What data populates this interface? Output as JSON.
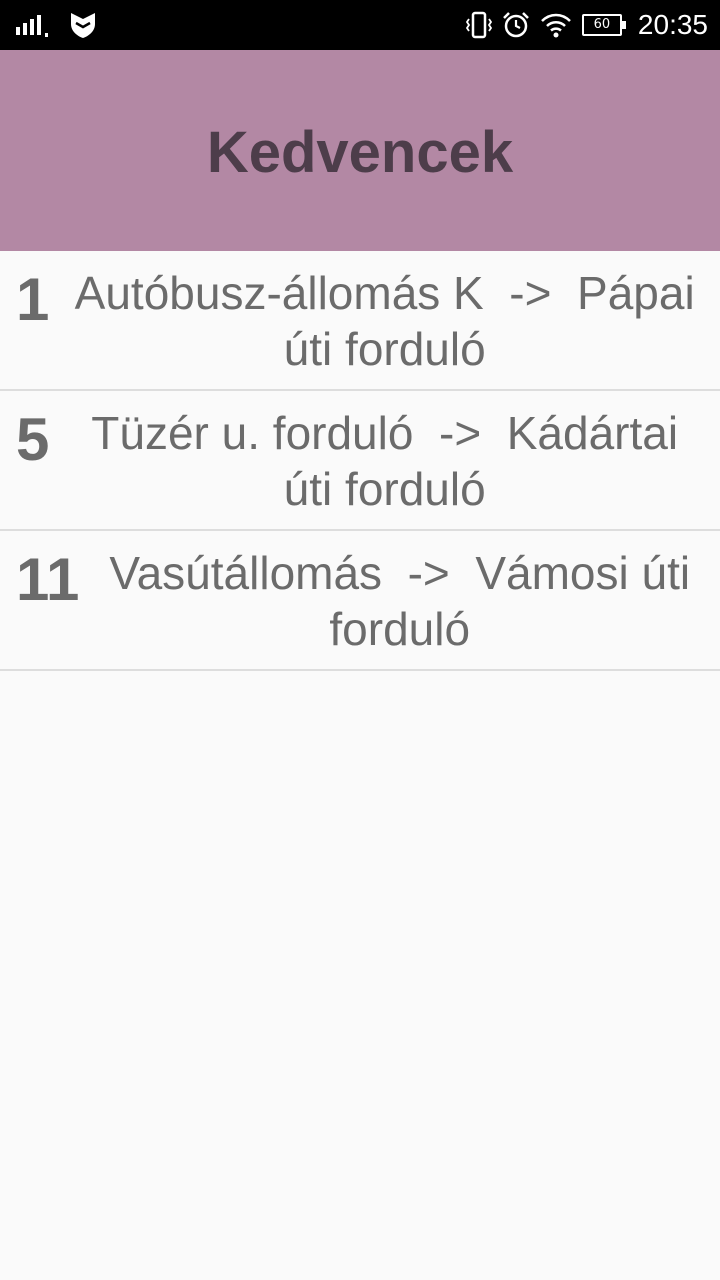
{
  "status_bar": {
    "time": "20:35",
    "battery_level": "60",
    "icons": [
      "signal-icon",
      "shield-icon",
      "vibrate-icon",
      "alarm-icon",
      "wifi-icon",
      "battery-icon"
    ]
  },
  "header": {
    "title": "Kedvencek",
    "background_color": "#b388a4"
  },
  "favorites": [
    {
      "line": "1",
      "route": "Autóbusz-állomás K  ->  Pápai úti forduló"
    },
    {
      "line": "5",
      "route": "Tüzér u. forduló  ->  Kádártai úti forduló"
    },
    {
      "line": "11",
      "route": "Vasútállomás  ->  Vámosi úti forduló"
    }
  ]
}
